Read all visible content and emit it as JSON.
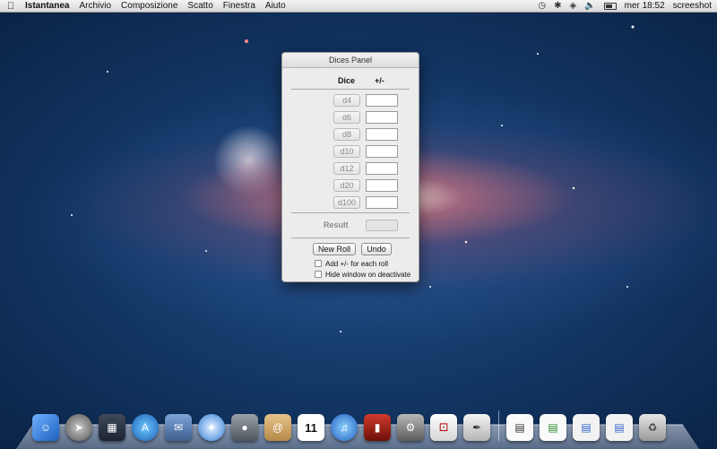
{
  "menubar": {
    "app_name": "Istantanea",
    "items": [
      "Archivio",
      "Composizione",
      "Scatto",
      "Finestra",
      "Aiuto"
    ],
    "clock": "mer 18:52",
    "user": "screeshot"
  },
  "panel": {
    "title": "Dices Panel",
    "header_dice": "Dice",
    "header_mod": "+/-",
    "dice": [
      "d4",
      "d6",
      "d8",
      "d10",
      "d12",
      "d20",
      "d100"
    ],
    "result_label": "Result",
    "new_roll": "New Roll",
    "undo": "Undo",
    "option_add": "Add +/- for each roll",
    "option_hide": "Hide window on deactivate"
  },
  "calendar_icon": {
    "month": "JUL",
    "day": "11"
  },
  "colors": {
    "accent_blue": "#1f5fbf"
  }
}
